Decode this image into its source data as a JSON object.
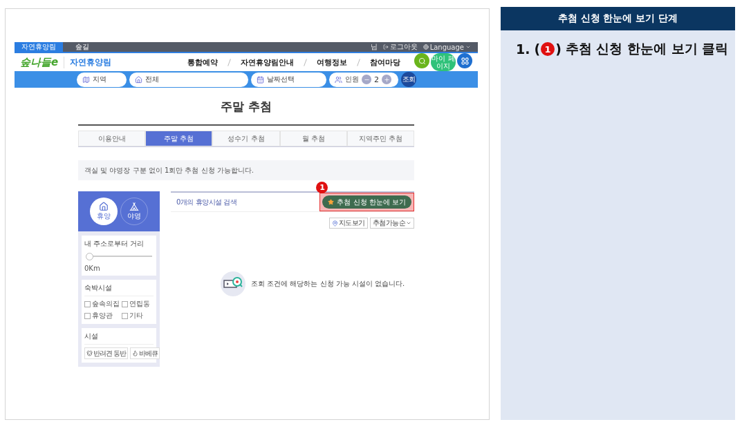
{
  "screenshot": {
    "top_bar": {
      "tabs": [
        {
          "label": "자연휴양림",
          "selected": true
        },
        {
          "label": "숲길",
          "selected": false
        }
      ],
      "user_suffix": "님",
      "logout": "로그아웃",
      "language": "Language"
    },
    "header": {
      "logo": "숲나들e",
      "site_name": "자연휴양림",
      "nav": [
        "통합예약",
        "자연휴양림안내",
        "여행정보",
        "참여마당"
      ],
      "my_page": "마이 페이지"
    },
    "search_bar": {
      "region": "지역",
      "facility": "전체",
      "date": "날짜선택",
      "people_label": "인원",
      "people_count": "2",
      "submit": "조회"
    },
    "page_title": "주말 추첨",
    "tabs": [
      {
        "label": "이용안내",
        "selected": false
      },
      {
        "label": "주말 추첨",
        "selected": true
      },
      {
        "label": "성수기 추첨",
        "selected": false
      },
      {
        "label": "월 추첨",
        "selected": false
      },
      {
        "label": "지역주민 추첨",
        "selected": false
      }
    ],
    "notice": "객실 및 야영장 구분 없이 1회만 추첨 신청 가능합니다.",
    "sidebar": {
      "types": [
        {
          "label": "휴양",
          "selected": true
        },
        {
          "label": "야영",
          "selected": false
        }
      ],
      "distance": {
        "label": "내 주소로부터 거리",
        "level": 0,
        "reading": "0Km"
      },
      "lodging": {
        "title": "숙박시설",
        "options": [
          {
            "label": "숲속의집",
            "checked": false
          },
          {
            "label": "연립동",
            "checked": false
          },
          {
            "label": "휴양관",
            "checked": false
          },
          {
            "label": "기타",
            "checked": false
          }
        ]
      },
      "facilities": {
        "title": "시설",
        "options": [
          {
            "label": "반려견 동반"
          },
          {
            "label": "바베큐"
          }
        ]
      }
    },
    "results": {
      "count_text": "0개의 휴양시설 검색",
      "overview_button": "추첨 신청 한눈에 보기",
      "callout": "1",
      "map_button": "지도보기",
      "sort": "추첨가능순",
      "empty_message": "조회 조건에 해당하는 신청 가능 시설이 없습니다."
    }
  },
  "guide": {
    "title": "추첨 신청 한눈에 보기 단계",
    "steps": [
      {
        "number": "1.",
        "open_paren": "(",
        "badge": "1",
        "close_paren": ")",
        "text": "추첨 신청 한눈에 보기 클릭"
      }
    ]
  }
}
